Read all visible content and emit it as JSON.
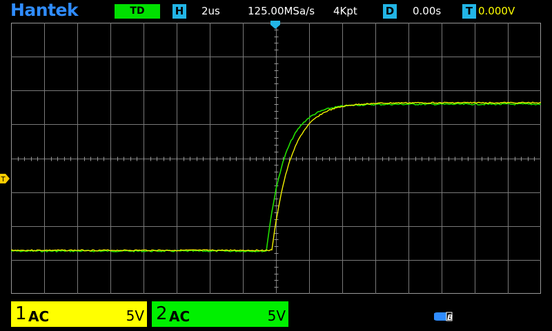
{
  "header": {
    "brand": "Hantek",
    "trigger_mode": "TD",
    "horizontal": {
      "icon": "H",
      "timebase": "2us",
      "sample_rate": "125.00MSa/s",
      "memory_depth": "4Kpt"
    },
    "delay": {
      "icon": "D",
      "value": "0.00s"
    },
    "trigger": {
      "icon": "T",
      "level": "0.000V"
    }
  },
  "markers": {
    "trigger_level_label": "T"
  },
  "channels": [
    {
      "number": "1",
      "coupling": "AC",
      "scale": "5V",
      "color": "#ffff00"
    },
    {
      "number": "2",
      "coupling": "AC",
      "scale": "5V",
      "color": "#00f000"
    }
  ],
  "status_icons": {
    "usb_label": "B"
  },
  "colors": {
    "brand": "#2f8cff",
    "trigger_mode_bg": "#00e000",
    "icon_bg": "#22b5e6",
    "trigger_level_text": "#ffff00",
    "grid": "#7a7a7a"
  }
}
